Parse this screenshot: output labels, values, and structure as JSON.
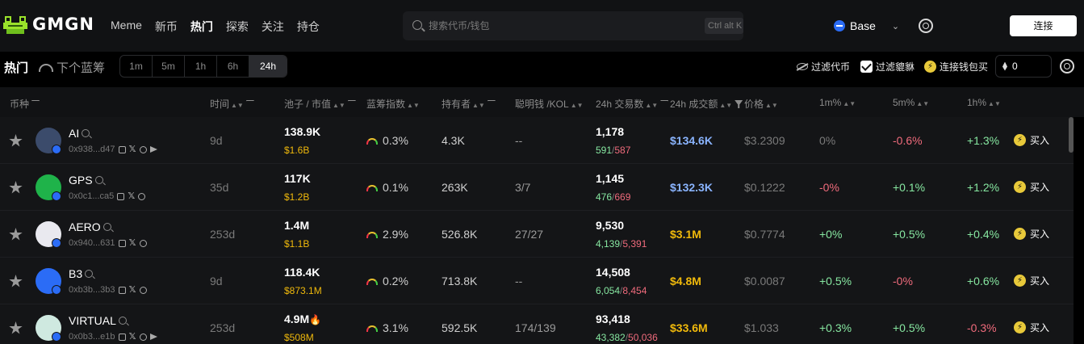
{
  "brand": {
    "name": "GMGN"
  },
  "nav": [
    "Meme",
    "新币",
    "热门",
    "探索",
    "关注",
    "持仓"
  ],
  "nav_active": 2,
  "search": {
    "placeholder": "搜索代币/钱包",
    "shortcut": "Ctrl alt K"
  },
  "chain": {
    "label": "Base",
    "color": "#2b6cf6"
  },
  "connect_label": "连接",
  "subbar": {
    "title": "热门",
    "next_blue": "下个蓝筹",
    "timeframes": [
      "1m",
      "5m",
      "1h",
      "6h",
      "24h"
    ],
    "active_timeframe": 4,
    "filter_tokens": "过滤代币",
    "filter_pumps": "过滤貔貅",
    "wallet_buy": "连接钱包买",
    "amount": "0"
  },
  "columns": {
    "token": "币种",
    "age": "时间",
    "pool_mcap": "池子 / 市值",
    "blue_index": "蓝筹指数",
    "holders": "持有者",
    "smart_kol": "聪明钱 /KOL",
    "txns": "24h 交易数",
    "volume": "24h 成交额",
    "price": "价格",
    "m1": "1m%",
    "m5": "5m%",
    "h1": "1h%"
  },
  "buy_label": "买入",
  "rows": [
    {
      "symbol": "AI",
      "address": "0x938...d47",
      "age": "9d",
      "pool": "138.9K",
      "mcap": "$1.6B",
      "blue": "0.3%",
      "holders": "4.3K",
      "smart": "--",
      "txns": "1,178",
      "buys": "591",
      "sells": "587",
      "volume": "$134.6K",
      "volume_color": "#8ab4ff",
      "price": "$3.2309",
      "m1": "0%",
      "m5": "-0.6%",
      "h1": "+1.3%",
      "avatar_color": "#3b4b6b",
      "telegram": true,
      "fire": false
    },
    {
      "symbol": "GPS",
      "address": "0x0c1...ca5",
      "age": "35d",
      "pool": "117K",
      "mcap": "$1.2B",
      "blue": "0.1%",
      "holders": "263K",
      "smart": "3/7",
      "txns": "1,145",
      "buys": "476",
      "sells": "669",
      "volume": "$132.3K",
      "volume_color": "#8ab4ff",
      "price": "$0.1222",
      "m1": "-0%",
      "m5": "+0.1%",
      "h1": "+1.2%",
      "avatar_color": "#1fb34a",
      "telegram": false,
      "fire": false
    },
    {
      "symbol": "AERO",
      "address": "0x940...631",
      "age": "253d",
      "pool": "1.4M",
      "mcap": "$1.1B",
      "blue": "2.9%",
      "holders": "526.8K",
      "smart": "27/27",
      "txns": "9,530",
      "buys": "4,139",
      "sells": "5,391",
      "volume": "$3.1M",
      "volume_color": "#f0b90b",
      "price": "$0.7774",
      "m1": "+0%",
      "m5": "+0.5%",
      "h1": "+0.4%",
      "avatar_color": "#e9e9ef",
      "telegram": false,
      "fire": false
    },
    {
      "symbol": "B3",
      "address": "0xb3b...3b3",
      "age": "9d",
      "pool": "118.4K",
      "mcap": "$873.1M",
      "blue": "0.2%",
      "holders": "713.8K",
      "smart": "--",
      "txns": "14,508",
      "buys": "6,054",
      "sells": "8,454",
      "volume": "$4.8M",
      "volume_color": "#f0b90b",
      "price": "$0.0087",
      "m1": "+0.5%",
      "m5": "-0%",
      "h1": "+0.6%",
      "avatar_color": "#2b6cf6",
      "telegram": false,
      "fire": false
    },
    {
      "symbol": "VIRTUAL",
      "address": "0x0b3...e1b",
      "age": "253d",
      "pool": "4.9M",
      "mcap": "$508M",
      "blue": "3.1%",
      "holders": "592.5K",
      "smart": "174/139",
      "txns": "93,418",
      "buys": "43,382",
      "sells": "50,036",
      "volume": "$33.6M",
      "volume_color": "#f0b90b",
      "price": "$1.033",
      "m1": "+0.3%",
      "m5": "+0.5%",
      "h1": "-0.3%",
      "avatar_color": "#cfe9e0",
      "telegram": true,
      "fire": true
    }
  ]
}
